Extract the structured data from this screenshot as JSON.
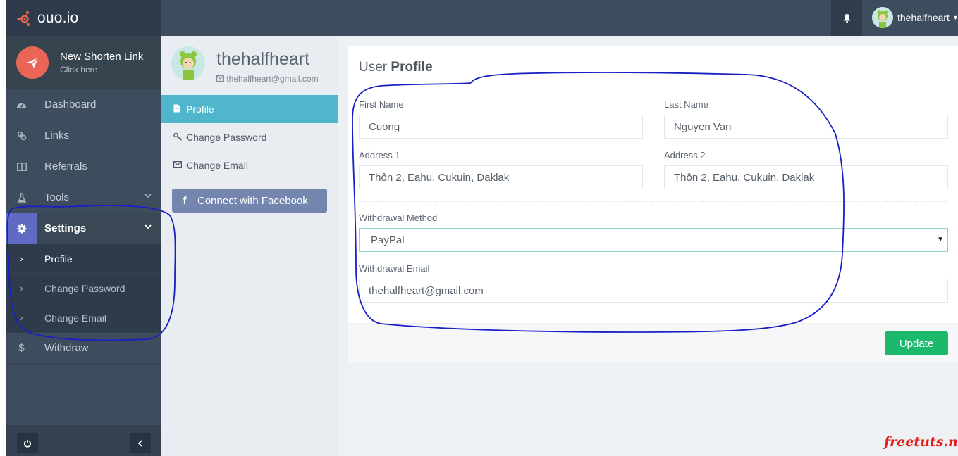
{
  "brand": {
    "name": "ouo.io",
    "icon": "ouo-logo-icon",
    "accent": "#e96656"
  },
  "shorten": {
    "title": "New Shorten Link",
    "subtitle": "Click here",
    "icon": "paper-plane-icon"
  },
  "nav": {
    "items": [
      {
        "label": "Dashboard",
        "icon": "dashboard-gauge-icon"
      },
      {
        "label": "Links",
        "icon": "link-icon"
      },
      {
        "label": "Referrals",
        "icon": "columns-icon"
      },
      {
        "label": "Tools",
        "icon": "flask-icon"
      },
      {
        "label": "Settings",
        "icon": "gear-icon"
      },
      {
        "label": "Withdraw",
        "icon": "dollar-icon"
      }
    ],
    "settings_sub": [
      {
        "label": "Profile"
      },
      {
        "label": "Change Password"
      },
      {
        "label": "Change Email"
      }
    ]
  },
  "topbar": {
    "username": "thehalfheart",
    "bell_icon": "bell-icon"
  },
  "profile_panel": {
    "name": "thehalfheart",
    "email": "thehalfheart@gmail.com",
    "menu": [
      {
        "label": "Profile",
        "icon": "file-icon"
      },
      {
        "label": "Change Password",
        "icon": "key-icon"
      },
      {
        "label": "Change Email",
        "icon": "envelope-icon"
      }
    ],
    "facebook_button": "Connect with Facebook"
  },
  "form": {
    "title_prefix": "User",
    "title_strong": "Profile",
    "first_name": {
      "label": "First Name",
      "value": "Cuong"
    },
    "last_name": {
      "label": "Last Name",
      "value": "Nguyen Van"
    },
    "address1": {
      "label": "Address 1",
      "value": "Thôn 2, Eahu, Cukuin, Daklak"
    },
    "address2": {
      "label": "Address 2",
      "value": "Thôn 2, Eahu, Cukuin, Daklak"
    },
    "withdrawal_method": {
      "label": "Withdrawal Method",
      "value": "PayPal"
    },
    "withdrawal_email": {
      "label": "Withdrawal Email",
      "value": "thehalfheart@gmail.com"
    },
    "update_button": "Update"
  },
  "watermark": "freetuts.net",
  "colors": {
    "sidebar": "#3e4d5e",
    "active_profile": "#4fb6cc",
    "facebook": "#7485ae",
    "update": "#1cb96d",
    "annotation": "#1a1fc4",
    "watermark": "#e0201a"
  }
}
